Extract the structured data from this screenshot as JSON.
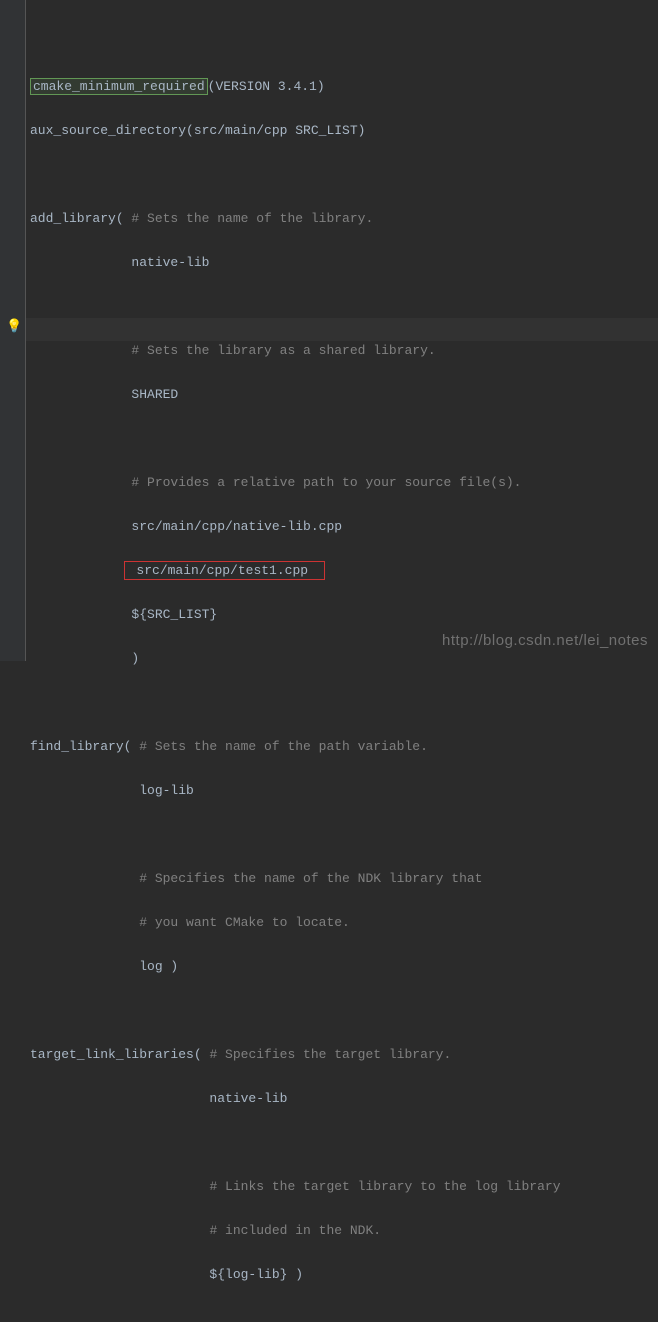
{
  "code": {
    "line1_cmd": "cmake_minimum_required",
    "line1_rest": "(VERSION 3.4.1)",
    "line2": "aux_source_directory(src/main/cpp SRC_LIST)",
    "line3": "",
    "line4_cmd": "add_library( ",
    "line4_comment": "# Sets the name of the library.",
    "line5": "             native-lib",
    "line6": "",
    "line7_indent": "             ",
    "line7_comment": "# Sets the library as a shared library.",
    "line8": "             SHARED",
    "line9": "",
    "line10_indent": "             ",
    "line10_comment": "# Provides a relative path to your source file(s).",
    "line11": "             src/main/cpp/native-lib.cpp",
    "line12_indent": "            ",
    "line12_highlighted": " src/main/cpp/test1.cpp ",
    "line13": "             ${SRC_LIST}",
    "line14": "             )",
    "line15": "",
    "line16_cmd": "find_library( ",
    "line16_comment": "# Sets the name of the path variable.",
    "line17": "              log-lib",
    "line18": "",
    "line19_indent": "              ",
    "line19_comment": "# Specifies the name of the NDK library that",
    "line20_indent": "              ",
    "line20_comment": "# you want CMake to locate.",
    "line21": "              log )",
    "line22": "",
    "line23_cmd": "target_link_libraries( ",
    "line23_comment": "# Specifies the target library.",
    "line24": "                       native-lib",
    "line25": "",
    "line26_indent": "                       ",
    "line26_comment": "# Links the target library to the log library",
    "line27_indent": "                       ",
    "line27_comment": "# included in the NDK.",
    "line28": "                       ${log-lib} )"
  },
  "icons": {
    "bulb": "💡"
  },
  "watermark": "http://blog.csdn.net/lei_notes"
}
